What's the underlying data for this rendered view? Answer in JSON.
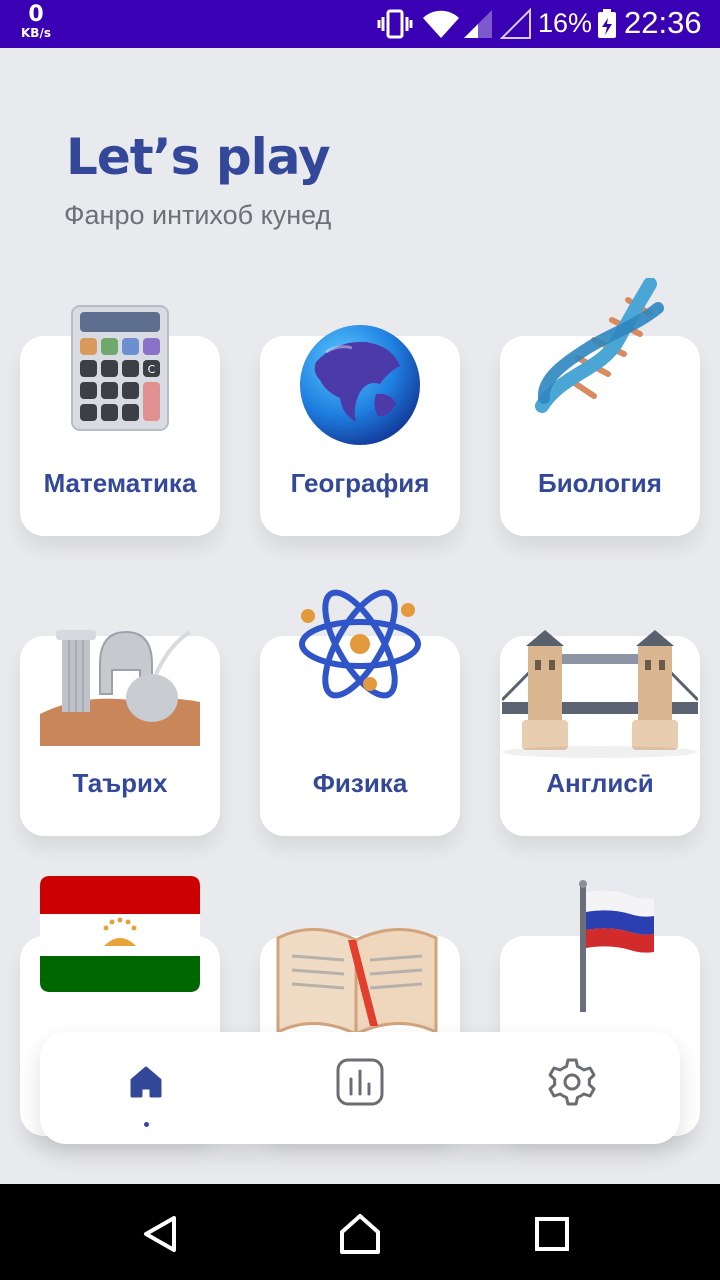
{
  "status_bar": {
    "net_speed": "0",
    "net_unit": "KB/s",
    "battery": "16%",
    "time": "22:36"
  },
  "header": {
    "title": "Let’s play",
    "subtitle": "Фанро интихоб кунед"
  },
  "subjects": [
    {
      "label": "Математика",
      "icon": "calculator-icon"
    },
    {
      "label": "География",
      "icon": "globe-icon"
    },
    {
      "label": "Биология",
      "icon": "dna-icon"
    },
    {
      "label": "Таърих",
      "icon": "history-icon"
    },
    {
      "label": "Физика",
      "icon": "atom-icon"
    },
    {
      "label": "Англисӣ",
      "icon": "tower-bridge-icon"
    },
    {
      "label": "",
      "icon": "tajik-flag-icon"
    },
    {
      "label": "",
      "icon": "open-book-icon"
    },
    {
      "label": "",
      "icon": "russian-flag-icon"
    }
  ],
  "bottom_nav": [
    {
      "name": "home",
      "icon": "home-icon",
      "active": true
    },
    {
      "name": "stats",
      "icon": "chart-icon"
    },
    {
      "name": "settings",
      "icon": "gear-icon"
    }
  ],
  "colors": {
    "accent": "#34489a",
    "status_bar": "#3a00b4",
    "background": "#e9eaee"
  }
}
